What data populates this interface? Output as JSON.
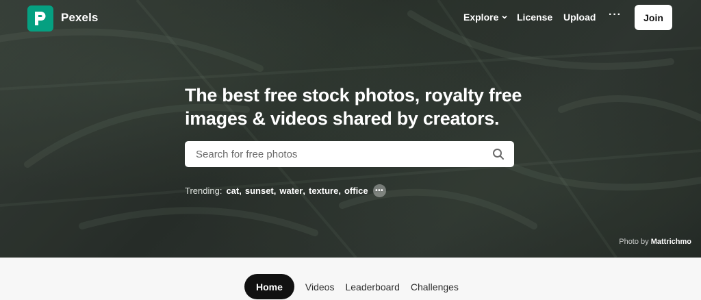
{
  "app": {
    "brand": "Pexels",
    "logo_letter": "P",
    "brand_color": "#05a081"
  },
  "nav": {
    "explore": "Explore",
    "license": "License",
    "upload": "Upload",
    "more": "···",
    "join": "Join"
  },
  "hero": {
    "headline": "The best free stock photos, royalty free images & videos shared by creators.",
    "search_placeholder": "Search for free photos",
    "trending_label": "Trending:",
    "trending": [
      "cat",
      "sunset",
      "water",
      "texture",
      "office"
    ],
    "trending_more": "•••",
    "credit_prefix": "Photo by",
    "credit_author": "Mattrichmo"
  },
  "tabs": [
    {
      "label": "Home",
      "active": true
    },
    {
      "label": "Videos",
      "active": false
    },
    {
      "label": "Leaderboard",
      "active": false
    },
    {
      "label": "Challenges",
      "active": false
    }
  ]
}
